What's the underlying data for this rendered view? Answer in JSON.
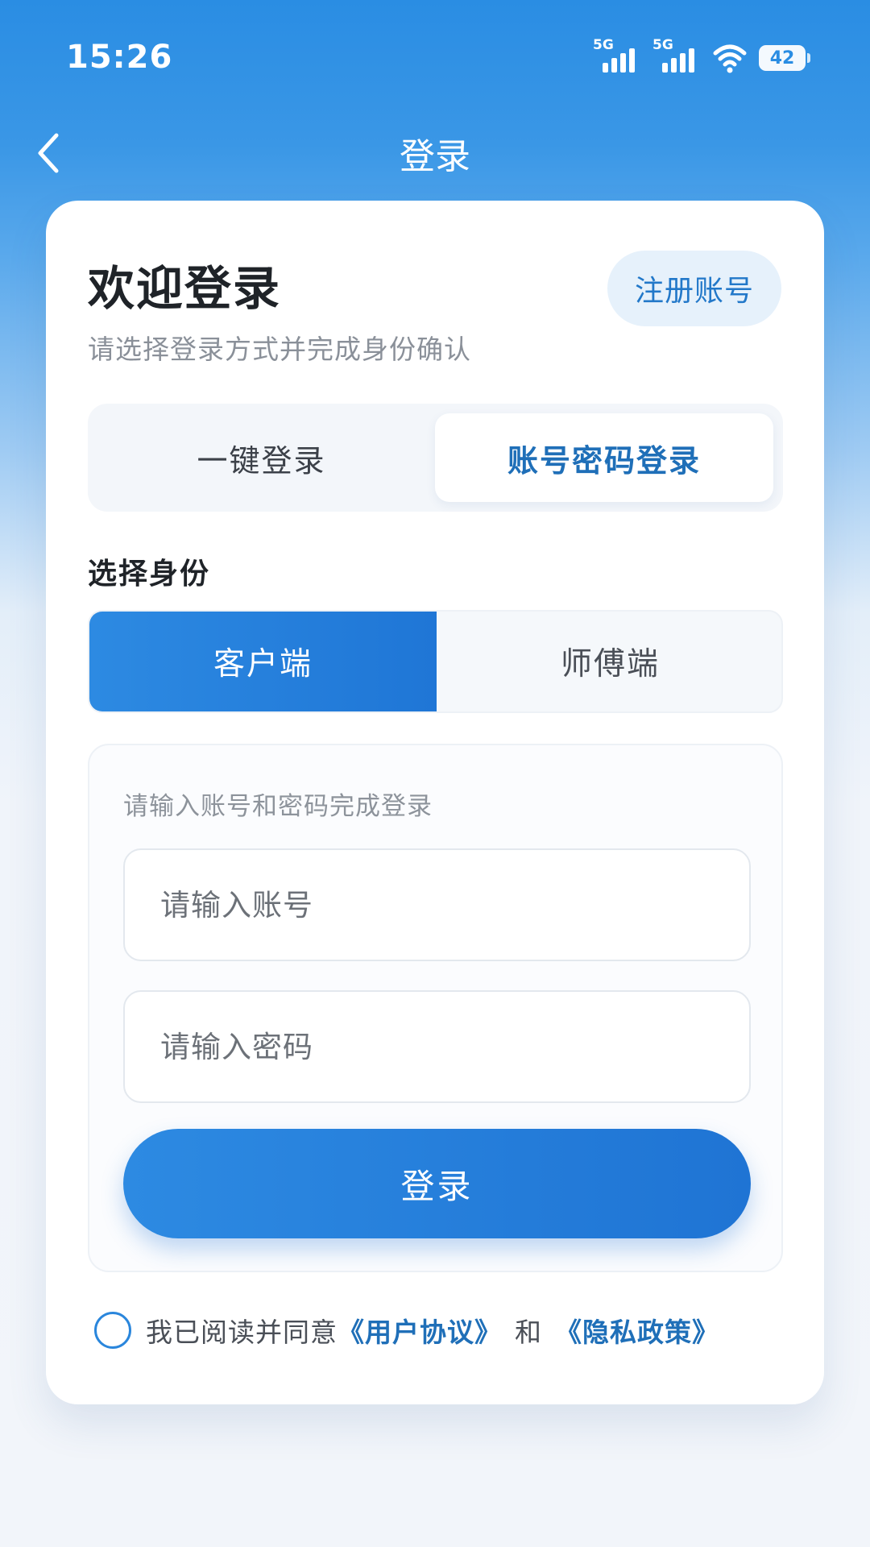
{
  "status_bar": {
    "time": "15:26",
    "signal_1_label": "5G",
    "signal_2_label": "5G",
    "battery": "42"
  },
  "header": {
    "title": "登录",
    "back_icon": "chevron-left-icon"
  },
  "welcome": {
    "title": "欢迎登录",
    "subtitle": "请选择登录方式并完成身份确认",
    "register_label": "注册账号"
  },
  "login_modes": [
    {
      "label": "一键登录",
      "selected": false
    },
    {
      "label": "账号密码登录",
      "selected": true
    }
  ],
  "identity": {
    "label": "选择身份",
    "options": [
      {
        "label": "客户端",
        "selected": true
      },
      {
        "label": "师傅端",
        "selected": false
      }
    ]
  },
  "form": {
    "hint": "请输入账号和密码完成登录",
    "account_placeholder": "请输入账号",
    "password_placeholder": "请输入密码",
    "submit_label": "登录"
  },
  "agreement": {
    "checked": false,
    "prefix": "我已阅读并同意",
    "user_agreement": "《用户协议》",
    "and": "和",
    "privacy_policy": "《隐私政策》"
  },
  "colors": {
    "primary": "#1f76d6",
    "link": "#1f6fb8",
    "header_bg": "#2a8de3"
  }
}
